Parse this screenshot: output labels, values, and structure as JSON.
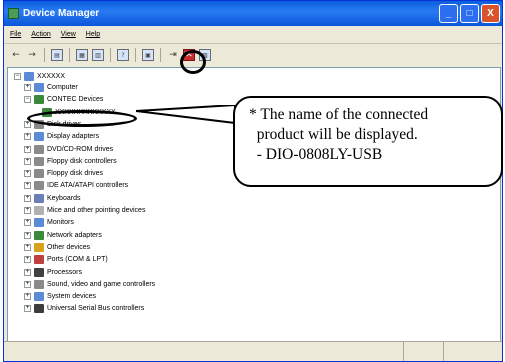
{
  "window": {
    "title": "Device Manager"
  },
  "title_buttons": [
    "_",
    "□",
    "X"
  ],
  "menu": [
    "File",
    "Action",
    "View",
    "Help"
  ],
  "toolbar": {
    "icons": [
      "back-arrow-icon",
      "forward-arrow-icon",
      "view-icon",
      "properties-icon",
      "print-icon",
      "help-icon",
      "scan-hardware-icon",
      "update-driver-icon",
      "uninstall-icon",
      "disable-icon"
    ]
  },
  "tree": {
    "root": "XXXXXX",
    "nodes": [
      {
        "label": "Computer",
        "expander": "+",
        "color": "#5b8bd6"
      },
      {
        "label": "CONTEC Devices",
        "expander": "−",
        "color": "#3a8a3a"
      },
      {
        "label": "XXXXXXXXXXXXX",
        "expander": "",
        "color": "#3a8a3a"
      },
      {
        "label": "Disk drives",
        "expander": "+",
        "color": "#8a8a8a"
      },
      {
        "label": "Display adapters",
        "expander": "+",
        "color": "#5b8bd6"
      },
      {
        "label": "DVD/CD-ROM drives",
        "expander": "+",
        "color": "#8a8a8a"
      },
      {
        "label": "Floppy disk controllers",
        "expander": "+",
        "color": "#8a8a8a"
      },
      {
        "label": "Floppy disk drives",
        "expander": "+",
        "color": "#8a8a8a"
      },
      {
        "label": "IDE ATA/ATAPI controllers",
        "expander": "+",
        "color": "#8a8a8a"
      },
      {
        "label": "Keyboards",
        "expander": "+",
        "color": "#6a7fb8"
      },
      {
        "label": "Mice and other pointing devices",
        "expander": "+",
        "color": "#b0b0b0"
      },
      {
        "label": "Monitors",
        "expander": "+",
        "color": "#5b8bd6"
      },
      {
        "label": "Network adapters",
        "expander": "+",
        "color": "#3a8a3a"
      },
      {
        "label": "Other devices",
        "expander": "+",
        "color": "#d9a21c"
      },
      {
        "label": "Ports (COM & LPT)",
        "expander": "+",
        "color": "#c04040"
      },
      {
        "label": "Processors",
        "expander": "+",
        "color": "#404040"
      },
      {
        "label": "Sound, video and game controllers",
        "expander": "+",
        "color": "#8a8a8a"
      },
      {
        "label": "System devices",
        "expander": "+",
        "color": "#5b8bd6"
      },
      {
        "label": "Universal Serial Bus controllers",
        "expander": "+",
        "color": "#3c3c3c"
      }
    ]
  },
  "callout": {
    "line1": "* The name of the connected",
    "line2": "  product will be displayed.",
    "line3": "  - DIO-0808LY-USB"
  }
}
